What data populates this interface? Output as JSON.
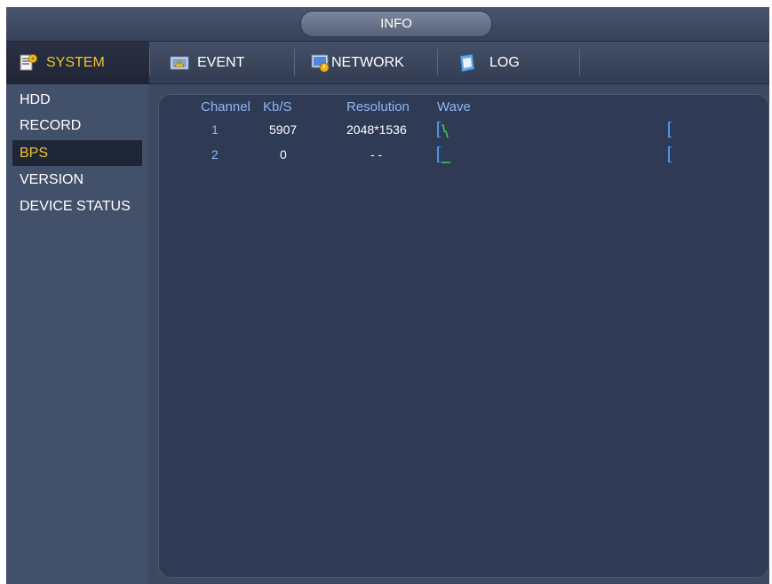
{
  "window": {
    "title": "INFO"
  },
  "tabs": [
    {
      "label": "SYSTEM",
      "icon": "system-settings-icon",
      "active": true
    },
    {
      "label": "EVENT",
      "icon": "event-alarm-icon",
      "active": false
    },
    {
      "label": "NETWORK",
      "icon": "network-info-icon",
      "active": false
    },
    {
      "label": "LOG",
      "icon": "log-book-icon",
      "active": false
    }
  ],
  "sidebar": {
    "items": [
      {
        "label": "HDD",
        "active": false
      },
      {
        "label": "RECORD",
        "active": false
      },
      {
        "label": "BPS",
        "active": true
      },
      {
        "label": "VERSION",
        "active": false
      },
      {
        "label": "DEVICE STATUS",
        "active": false
      }
    ]
  },
  "bps_table": {
    "headers": {
      "channel": "Channel",
      "kbs": "Kb/S",
      "resolution": "Resolution",
      "wave": "Wave"
    },
    "rows": [
      {
        "channel": "1",
        "kbs": "5907",
        "resolution": "2048*1536"
      },
      {
        "channel": "2",
        "kbs": "0",
        "resolution": "- -"
      }
    ]
  },
  "colors": {
    "accent_active": "#f0c330",
    "header_text": "#8fb6f2",
    "wave_green": "#35d04a"
  }
}
